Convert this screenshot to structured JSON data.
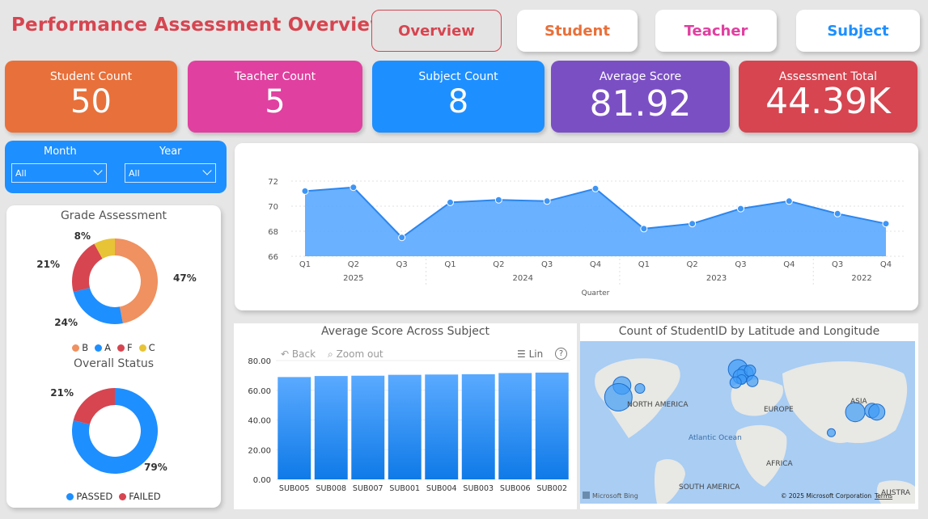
{
  "header": {
    "title": "Performance Assessment Overview"
  },
  "nav": [
    {
      "label": "Overview",
      "color": "#d64550"
    },
    {
      "label": "Student",
      "color": "#e8703a"
    },
    {
      "label": "Teacher",
      "color": "#e040a0"
    },
    {
      "label": "Subject",
      "color": "#1e8fff"
    }
  ],
  "kpis": [
    {
      "label": "Student Count",
      "value": "50",
      "color": "#e8703a"
    },
    {
      "label": "Teacher Count",
      "value": "5",
      "color": "#e040a0"
    },
    {
      "label": "Subject Count",
      "value": "8",
      "color": "#1e8fff"
    },
    {
      "label": "Average Score",
      "value": "81.92",
      "color": "#7b4fc4"
    },
    {
      "label": "Assessment Total",
      "value": "44.39K",
      "color": "#d64550"
    }
  ],
  "filters": {
    "month": {
      "label": "Month",
      "value": "All"
    },
    "year": {
      "label": "Year",
      "value": "All"
    }
  },
  "grade": {
    "title": "Grade Assessment",
    "legend": [
      "B",
      "A",
      "F",
      "C"
    ]
  },
  "status": {
    "title": "Overall Status",
    "legend": [
      "PASSED",
      "FAILED"
    ]
  },
  "bar_toolbar": {
    "back": "Back",
    "zoom": "Zoom out",
    "lin": "Lin",
    "help": "?"
  },
  "map": {
    "title": "Count of StudentID by Latitude and Longitude",
    "labels": {
      "na": "NORTH AMERICA",
      "eu": "EUROPE",
      "asia": "ASIA",
      "africa": "AFRICA",
      "sa": "SOUTH AMERICA",
      "ocean": "Atlantic Ocean",
      "aus": "AUSTRA",
      "bing": "Microsoft Bing",
      "copy": "© 2025 Microsoft Corporation",
      "terms": "Terms"
    }
  },
  "chart_data": [
    {
      "type": "area",
      "title": "",
      "xlabel": "Quarter",
      "ylabel": "",
      "ylim": [
        66,
        72
      ],
      "yticks": [
        66,
        68,
        70,
        72
      ],
      "x": [
        "Q1",
        "Q2",
        "Q3",
        "Q1",
        "Q2",
        "Q3",
        "Q4",
        "Q1",
        "Q2",
        "Q3",
        "Q4",
        "Q3",
        "Q4"
      ],
      "x_groups": [
        {
          "label": "2025",
          "count": 3
        },
        {
          "label": "2024",
          "count": 4
        },
        {
          "label": "2023",
          "count": 4
        },
        {
          "label": "2022",
          "count": 2
        }
      ],
      "values": [
        71.2,
        71.5,
        67.5,
        70.3,
        70.5,
        70.4,
        71.4,
        68.2,
        68.6,
        69.8,
        70.4,
        69.4,
        68.6
      ],
      "color": "#5aa9ff"
    },
    {
      "type": "donut",
      "title": "Grade Assessment",
      "categories": [
        "B",
        "A",
        "F",
        "C"
      ],
      "values": [
        47,
        24,
        21,
        8
      ],
      "labels": [
        "47%",
        "24%",
        "21%",
        "8%"
      ],
      "colors": [
        "#ef9160",
        "#1e8fff",
        "#d64550",
        "#e7c336"
      ]
    },
    {
      "type": "donut",
      "title": "Overall Status",
      "categories": [
        "PASSED",
        "FAILED"
      ],
      "values": [
        79,
        21
      ],
      "labels": [
        "79%",
        "21%"
      ],
      "colors": [
        "#1e8fff",
        "#d64550"
      ]
    },
    {
      "type": "bar",
      "title": "Average Score Across Subject",
      "categories": [
        "SUB005",
        "SUB008",
        "SUB007",
        "SUB001",
        "SUB004",
        "SUB003",
        "SUB006",
        "SUB002"
      ],
      "values": [
        68.9,
        69.6,
        69.8,
        70.4,
        70.6,
        70.8,
        71.6,
        71.9
      ],
      "ylim": [
        0,
        80
      ],
      "yticks": [
        "0.00",
        "20.00",
        "40.00",
        "60.00",
        "80.00"
      ],
      "color": "#2b8ff5"
    },
    {
      "type": "scatter",
      "title": "Count of StudentID by Latitude and Longitude",
      "x": [
        -95,
        -98,
        -80,
        2,
        8,
        4,
        12,
        5,
        0,
        14,
        100,
        114,
        118,
        80
      ],
      "y": [
        40,
        32,
        38,
        51,
        48,
        46,
        50,
        44,
        42,
        43,
        22,
        23,
        22,
        8
      ],
      "sizes": [
        11,
        17,
        6,
        12,
        10,
        9,
        7,
        6,
        7,
        7,
        12,
        9,
        10,
        5
      ],
      "color": "#3f9bf7"
    }
  ]
}
